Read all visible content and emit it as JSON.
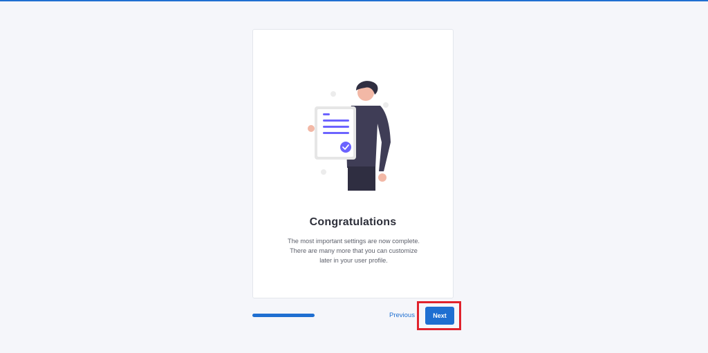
{
  "dialog": {
    "title": "Congratulations",
    "description": "The most important settings are now complete. There are many more that you can customize later in your user profile.",
    "illustration": "person-holding-checked-document"
  },
  "footer": {
    "progress_percent": 100,
    "previous_label": "Previous",
    "next_label": "Next"
  },
  "colors": {
    "accent": "#1f6fd1",
    "highlight": "#e0222c",
    "check_purple": "#6c63ff",
    "figure_dark": "#3f3d56"
  }
}
